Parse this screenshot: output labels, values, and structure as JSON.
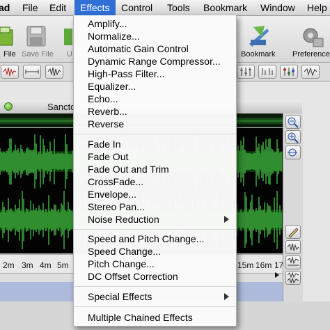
{
  "menubar": {
    "items": [
      {
        "label": "ad"
      },
      {
        "label": "File"
      },
      {
        "label": "Edit"
      },
      {
        "label": "Effects"
      },
      {
        "label": "Control"
      },
      {
        "label": "Tools"
      },
      {
        "label": "Bookmark"
      },
      {
        "label": "Window"
      },
      {
        "label": "Help"
      }
    ]
  },
  "toolbar": {
    "file_label": "File",
    "save_file_label": "Save File",
    "partial_label": "U",
    "bookmark_label": "Bookmark",
    "preferences_label": "Preference"
  },
  "document": {
    "title": "Sancto",
    "ruler_labels": [
      "2m",
      "3m",
      "4m",
      "5m",
      "15m",
      "16m",
      "17"
    ]
  },
  "effects_menu": {
    "groups": [
      [
        {
          "label": "Amplify..."
        },
        {
          "label": "Normalize..."
        },
        {
          "label": "Automatic Gain Control"
        },
        {
          "label": "Dynamic Range Compressor..."
        },
        {
          "label": "High-Pass Filter..."
        },
        {
          "label": "Equalizer..."
        },
        {
          "label": "Echo..."
        },
        {
          "label": "Reverb..."
        },
        {
          "label": "Reverse"
        }
      ],
      [
        {
          "label": "Fade In"
        },
        {
          "label": "Fade Out"
        },
        {
          "label": "Fade Out and Trim"
        },
        {
          "label": "CrossFade..."
        },
        {
          "label": "Envelope..."
        },
        {
          "label": "Stereo Pan..."
        },
        {
          "label": "Noise Reduction"
        }
      ],
      [
        {
          "label": "Speed and Pitch Change..."
        },
        {
          "label": "Speed Change..."
        },
        {
          "label": "Pitch Change..."
        },
        {
          "label": "DC Offset Correction"
        }
      ],
      [
        {
          "label": "Special Effects"
        }
      ],
      [
        {
          "label": "Multiple Chained Effects"
        }
      ]
    ]
  },
  "colors": {
    "menu_highlight": "#2f6fd6",
    "waveform": "#3aa13a",
    "waveform_dark": "#0d3f0d"
  }
}
